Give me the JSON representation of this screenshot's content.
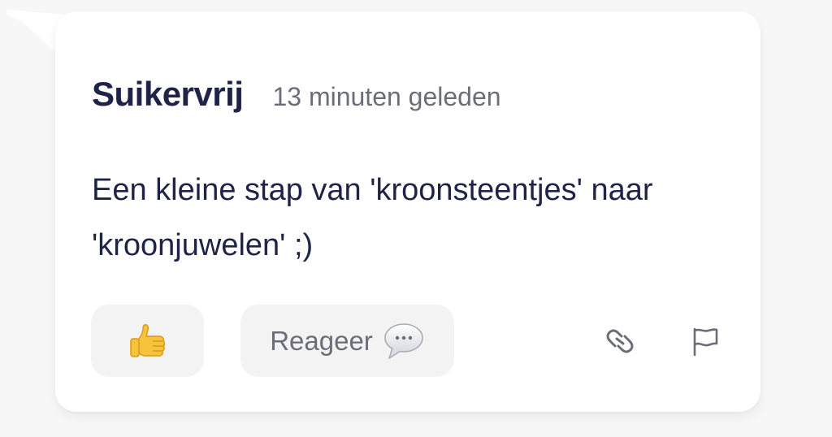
{
  "comment": {
    "author": "Suikervrij",
    "timestamp": "13 minuten geleden",
    "text": "Een kleine stap van 'kroonsteentjes' naar 'kroonjuwelen' ;)"
  },
  "actions": {
    "like_icon": "thumbs-up-emoji",
    "reply_label": "Reageer",
    "reply_icon": "speech-bubble-emoji",
    "link_icon": "link-icon",
    "report_icon": "flag-icon"
  },
  "colors": {
    "text_primary": "#1e2347",
    "text_secondary": "#6b6e78",
    "button_bg": "#f3f3f4",
    "card_bg": "#ffffff"
  }
}
